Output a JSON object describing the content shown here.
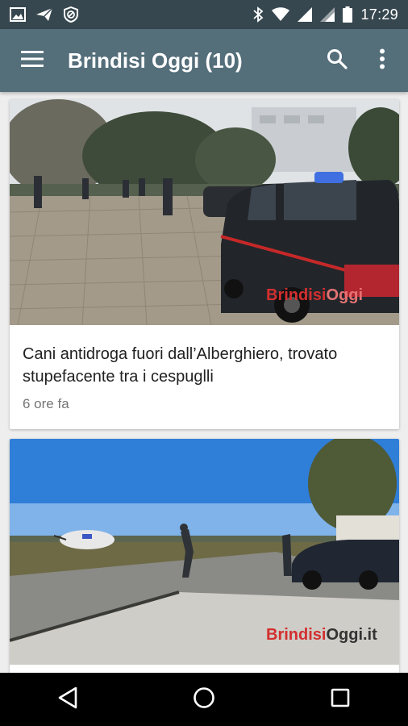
{
  "status_bar": {
    "time": "17:29",
    "left_icons": [
      "image-icon",
      "paper-plane-icon",
      "blocked-icon"
    ],
    "right_icons": [
      "bluetooth-icon",
      "wifi-icon",
      "signal-icon",
      "signal-icon",
      "battery-icon"
    ]
  },
  "app_bar": {
    "title": "Brindisi Oggi (10)",
    "background": "#546e7a",
    "icons": [
      "menu-icon",
      "search-icon",
      "more-vert-icon"
    ]
  },
  "articles": [
    {
      "title": "Cani antidroga fuori dall’Alberghiero, trovato stupefacente tra i cespuglli",
      "time": "6 ore fa",
      "watermark_a": "Brindisi",
      "watermark_b": "Oggi"
    },
    {
      "title": "",
      "time": "",
      "watermark_a": "Brindisi",
      "watermark_b": "Oggi.it"
    }
  ],
  "nav_bar": {
    "icons": [
      "back-icon",
      "home-icon",
      "recents-icon"
    ]
  }
}
